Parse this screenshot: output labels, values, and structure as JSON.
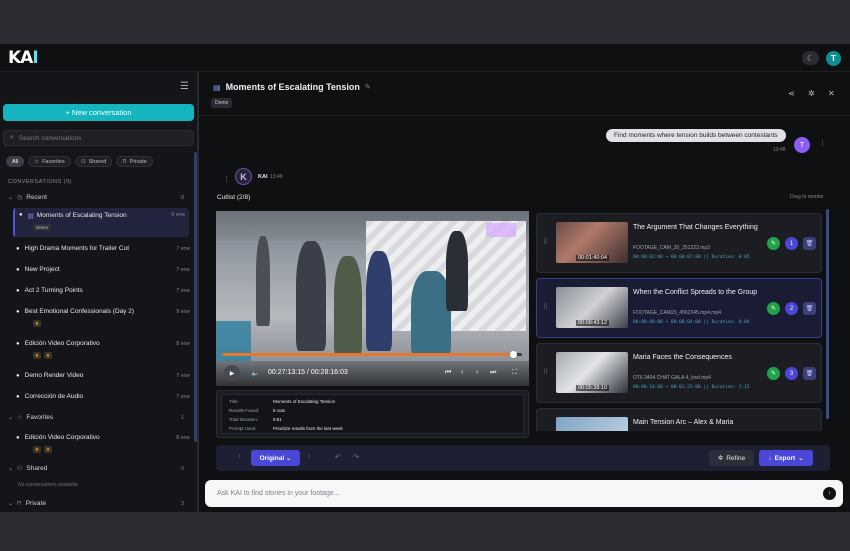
{
  "app": {
    "logo_main": "KA",
    "logo_accent": "I",
    "user_initial": "T",
    "theme_icon": "moon-icon"
  },
  "sidebar": {
    "new_conversation": "+ New conversation",
    "search_placeholder": "Search conversations",
    "filters": [
      {
        "label": "All",
        "icon": ""
      },
      {
        "label": "Favorites",
        "icon": "star-icon"
      },
      {
        "label": "Shared",
        "icon": "users-icon"
      },
      {
        "label": "Private",
        "icon": "lock-icon"
      }
    ],
    "section_label": "CONVERSATIONS (9)",
    "groups": {
      "recent": {
        "label": "Recent",
        "count": "8"
      },
      "favorites": {
        "label": "Favorites",
        "count": "1"
      },
      "shared": {
        "label": "Shared",
        "count": "0"
      },
      "private": {
        "label": "Private",
        "count": "3"
      }
    },
    "recent_items": [
      {
        "title": "Moments of Escalating Tension",
        "date": "9 ene",
        "tag": "Demo"
      },
      {
        "title": "High Drama Moments for Trailer Cut",
        "date": "7 ene"
      },
      {
        "title": "New Project",
        "date": "7 ene"
      },
      {
        "title": "Act 2 Turning Points",
        "date": "7 ene"
      },
      {
        "title": "Best Emotional Confessionals (Day 2)",
        "date": "9 ene"
      },
      {
        "title": "Edición Video Corporativo",
        "date": "8 ene"
      },
      {
        "title": "Demo Render Video",
        "date": "7 ene"
      },
      {
        "title": "Corrección de Audio",
        "date": "7 ene"
      }
    ],
    "favorite_items": [
      {
        "title": "Edición Video Corporativo",
        "date": "8 ene"
      }
    ],
    "shared_empty": "No conversations available"
  },
  "main": {
    "title": "Moments of Escalating Tension",
    "tag": "Demo",
    "user_message": "Find moments where tension builds between contestants",
    "user_time": "13:48",
    "bot_name": "KAI",
    "bot_time": "13:49",
    "cutlist_label": "Cutlist (2/8)",
    "drag_label": "Drag to reorder",
    "player": {
      "timecode": "00:27:13:15 / 00:28:16:03",
      "progress": 0.97
    },
    "info": [
      {
        "k": "Title:",
        "v": "Moments of Escalating Tension"
      },
      {
        "k": "Results Found:",
        "v": "8 cuts"
      },
      {
        "k": "Total Duration:",
        "v": "9:51"
      },
      {
        "k": "Prompt Used:",
        "v": "Prioritize results from the last week"
      }
    ],
    "clips": [
      {
        "title": "The Argument That Changes Everything",
        "file": "FOOTAGE_CAM_20_251223.mp3",
        "meta": "00:00:02:00 → 00:00:07:00  ||  Duration: 0:05",
        "tc": "00:01:40:04",
        "num": "1"
      },
      {
        "title": "When the Conflict Spreads to the Group",
        "file": "FOOTAGE_CAM23_4562345.mp4.mp4",
        "meta": "00:00:00:00 → 00:00:04:00  ||  Duration: 0:04",
        "tc": "00:08:43:12",
        "num": "2"
      },
      {
        "title": "Maria Faces the Consequences",
        "file": "OT6 3404 CHAT GALA 4_lowl.mp4",
        "meta": "00:00:10:00 → 00:01:25:00  ||  Duration: 1:15",
        "tc": "00:05:38:10",
        "num": "3"
      },
      {
        "title": "Main Tension Arc – Alex & Maria",
        "file": "",
        "meta": "",
        "tc": "",
        "num": "4"
      }
    ],
    "toolbar": {
      "version": "Original",
      "refine": "Refine",
      "export": "Export"
    },
    "composer_placeholder": "Ask KAI to find stories in your footage..."
  },
  "colors": {
    "accent": "#14b5bf",
    "primary": "#4b47d6",
    "progress": "#e8762c"
  }
}
